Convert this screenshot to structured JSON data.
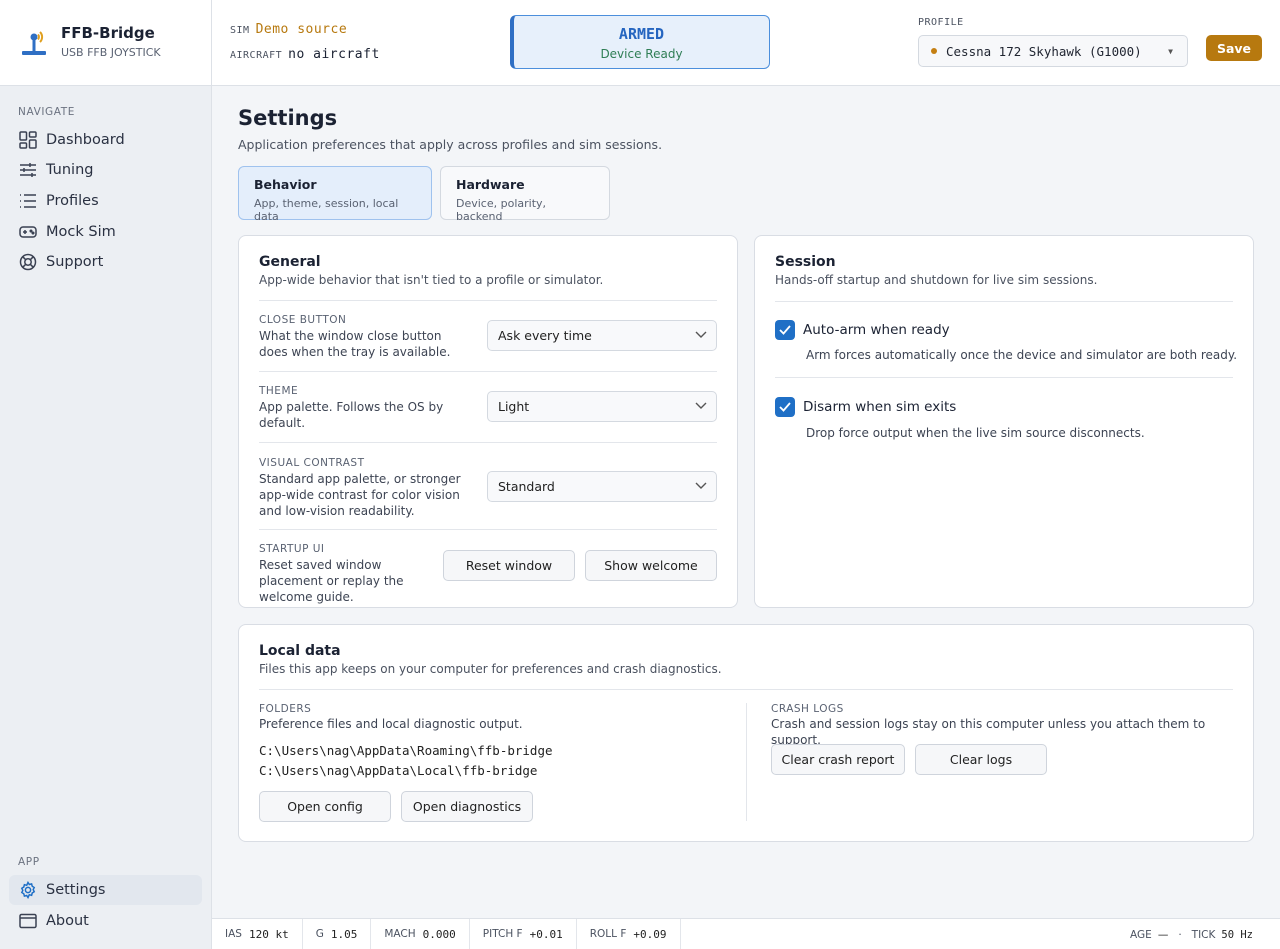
{
  "brand": {
    "name": "FFB-Bridge",
    "subtitle": "USB FFB JOYSTICK"
  },
  "sidebar": {
    "navigate_label": "NAVIGATE",
    "items": [
      {
        "label": "Dashboard",
        "icon": "dashboard-icon"
      },
      {
        "label": "Tuning",
        "icon": "sliders-icon"
      },
      {
        "label": "Profiles",
        "icon": "list-icon"
      },
      {
        "label": "Mock Sim",
        "icon": "gamepad-icon"
      },
      {
        "label": "Support",
        "icon": "lifebuoy-icon"
      }
    ],
    "app_label": "APP",
    "app_items": [
      {
        "label": "Settings",
        "icon": "gear-icon",
        "active": true
      },
      {
        "label": "About",
        "icon": "window-icon"
      }
    ]
  },
  "topbar": {
    "sim_label": "SIM",
    "sim_value": "Demo source",
    "aircraft_label": "AIRCRAFT",
    "aircraft_value": "no aircraft",
    "status_title": "ARMED",
    "status_sub": "Device Ready",
    "profile_label": "PROFILE",
    "profile_value": "Cessna 172 Skyhawk (G1000)",
    "save_label": "Save"
  },
  "page": {
    "title": "Settings",
    "subtitle": "Application preferences that apply across profiles and sim sessions.",
    "tabs": [
      {
        "label": "Behavior",
        "sub": "App, theme, session, local data",
        "active": true
      },
      {
        "label": "Hardware",
        "sub": "Device, polarity, backend"
      }
    ]
  },
  "general": {
    "title": "General",
    "subtitle": "App-wide behavior that isn't tied to a profile or simulator.",
    "close_button": {
      "label": "CLOSE BUTTON",
      "desc": "What the window close button does when the tray is available.",
      "value": "Ask every time"
    },
    "theme": {
      "label": "THEME",
      "desc": "App palette. Follows the OS by default.",
      "value": "Light"
    },
    "contrast": {
      "label": "VISUAL CONTRAST",
      "desc": "Standard app palette, or stronger app-wide contrast for color vision and low-vision readability.",
      "value": "Standard"
    },
    "startup": {
      "label": "STARTUP UI",
      "desc": "Reset saved window placement or replay the welcome guide.",
      "reset": "Reset window",
      "welcome": "Show welcome"
    }
  },
  "session": {
    "title": "Session",
    "subtitle": "Hands-off startup and shutdown for live sim sessions.",
    "auto_arm": {
      "label": "Auto-arm when ready",
      "desc": "Arm forces automatically once the device and simulator are both ready.",
      "checked": true
    },
    "disarm": {
      "label": "Disarm when sim exits",
      "desc": "Drop force output when the live sim source disconnects.",
      "checked": true
    }
  },
  "local_data": {
    "title": "Local data",
    "subtitle": "Files this app keeps on your computer for preferences and crash diagnostics.",
    "folders_label": "FOLDERS",
    "folders_desc": "Preference files and local diagnostic output.",
    "path_roaming": "C:\\Users\\nag\\AppData\\Roaming\\ffb-bridge",
    "path_local": "C:\\Users\\nag\\AppData\\Local\\ffb-bridge",
    "open_config": "Open config",
    "open_diagnostics": "Open diagnostics",
    "crash_label": "CRASH LOGS",
    "crash_desc": "Crash and session logs stay on this computer unless you attach them to support.",
    "clear_crash": "Clear crash report",
    "clear_logs": "Clear logs"
  },
  "statusbar": {
    "ias_label": "IAS",
    "ias_value": "120 kt",
    "g_label": "G",
    "g_value": "1.05",
    "mach_label": "MACH",
    "mach_value": "0.000",
    "pitch_label": "PITCH F",
    "pitch_value": "+0.01",
    "roll_label": "ROLL F",
    "roll_value": "+0.09",
    "age_label": "AGE",
    "age_value": "—",
    "sep": "·",
    "tick_label": "TICK",
    "tick_value": "50 Hz"
  },
  "colors": {
    "accent": "#1f6fc6",
    "save": "#b7790f",
    "armed": "#2565c0",
    "ready": "#2f7e55"
  }
}
